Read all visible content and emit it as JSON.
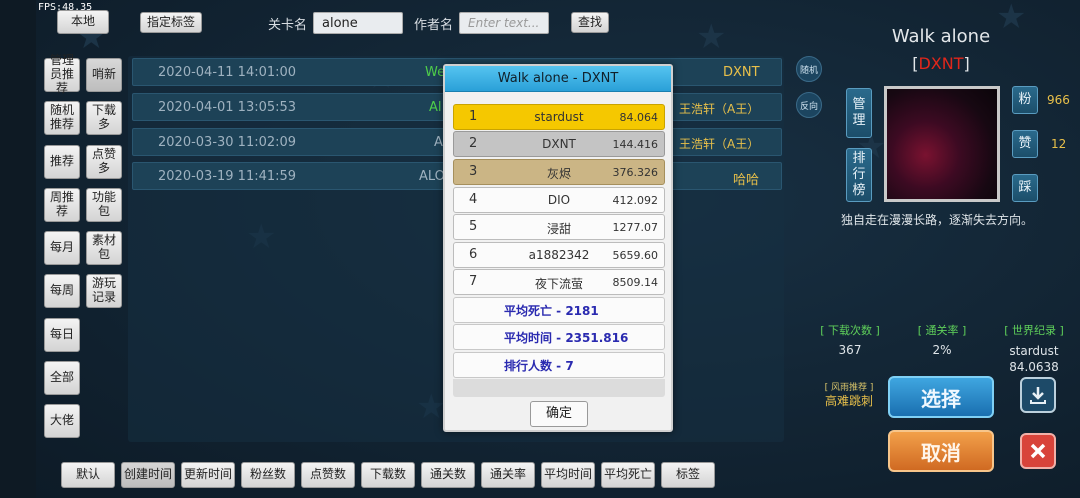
{
  "fps": "FPS:48.35",
  "top": {
    "local_btn": "本地",
    "tag_btn": "指定标签",
    "level_label": "关卡名",
    "level_value": "alone",
    "author_label": "作者名",
    "author_placeholder": "Enter text...",
    "search_btn": "查找"
  },
  "left_nav": [
    "管理员推荐",
    "随机推荐",
    "推荐",
    "周推荐",
    "每月",
    "每周",
    "每日",
    "全部",
    "大佬"
  ],
  "left_nav2": [
    "哨新",
    "下载多",
    "点赞多",
    "功能包",
    "素材包",
    "游玩记录"
  ],
  "levels": [
    {
      "date": "2020-04-11 14:01:00",
      "name": "We",
      "author": "DXNT"
    },
    {
      "date": "2020-04-01 13:05:53",
      "name": "Al",
      "author": "王浩轩（A王）"
    },
    {
      "date": "2020-03-30 11:02:09",
      "name": "A",
      "author": "王浩轩（A王）"
    },
    {
      "date": "2020-03-19 11:41:59",
      "name": "ALO",
      "author": "哈哈"
    }
  ],
  "mid_icons": {
    "random": "随机",
    "reverse": "反向"
  },
  "detail": {
    "title": "Walk alone",
    "author": "DXNT",
    "manage_btn": "管理",
    "rank_btn": "排行榜",
    "fans_label": "粉",
    "fans_value": "966",
    "like_label": "赞",
    "like_value": "12",
    "dislike_label": "踩",
    "description": "独自走在漫漫长路，逐渐失去方向。",
    "stats": [
      {
        "label": "[ 下载次数 ]",
        "value": "367"
      },
      {
        "label": "[ 通关率 ]",
        "value": "2%"
      },
      {
        "label": "[ 世界纪录 ]",
        "value": "stardust\n84.0638"
      }
    ],
    "tag_small": "[ 风雨推荐 ]",
    "tag_main": "高难跳刺",
    "select_btn": "选择",
    "cancel_btn": "取消"
  },
  "sort_buttons": [
    "默认",
    "创建时间",
    "更新时间",
    "粉丝数",
    "点赞数",
    "下载数",
    "通关数",
    "通关率",
    "平均时间",
    "平均死亡",
    "标签"
  ],
  "modal": {
    "title": "Walk alone - DXNT",
    "rows": [
      {
        "rank": "1",
        "name": "stardust",
        "time": "84.064",
        "style": "gold"
      },
      {
        "rank": "2",
        "name": "DXNT",
        "time": "144.416",
        "style": "silver"
      },
      {
        "rank": "3",
        "name": "灰烬",
        "time": "376.326",
        "style": "bronze"
      },
      {
        "rank": "4",
        "name": "DIO",
        "time": "412.092",
        "style": ""
      },
      {
        "rank": "5",
        "name": "浸甜",
        "time": "1277.07",
        "style": ""
      },
      {
        "rank": "6",
        "name": "a1882342",
        "time": "5659.60",
        "style": ""
      },
      {
        "rank": "7",
        "name": "夜下流萤",
        "time": "8509.14",
        "style": ""
      }
    ],
    "avg_death": "平均死亡 - 2181",
    "avg_time": "平均时间 - 2351.816",
    "rank_count": "排行人数 - 7",
    "ok_btn": "确定"
  },
  "colors": {
    "accent": "#2aa0d8",
    "gold": "#f5c800",
    "author_red": "#e0261b",
    "green": "#5fd05a",
    "yellow": "#e8c04a"
  }
}
